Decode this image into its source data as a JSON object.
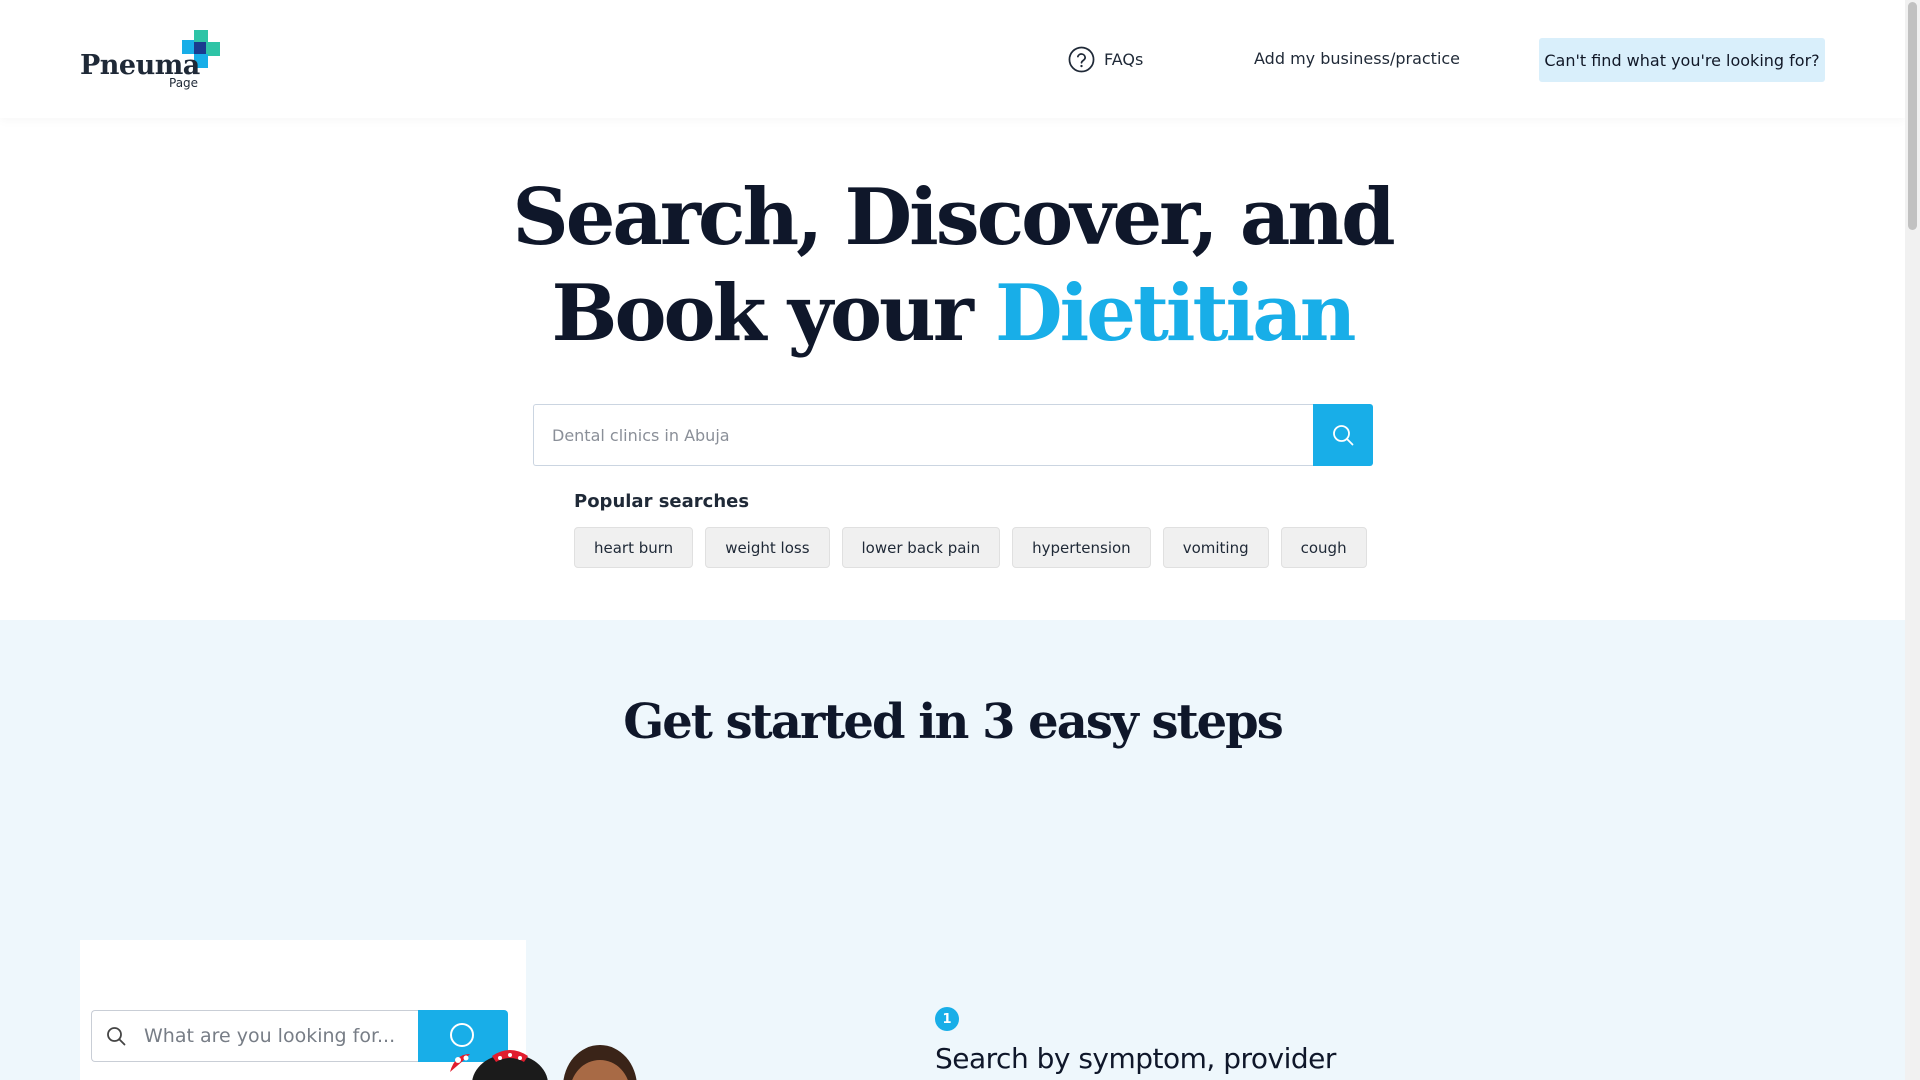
{
  "header": {
    "logo_text": "Pneuma",
    "logo_sub": "Page",
    "faq_label": "FAQs",
    "add_business_label": "Add my business/practice",
    "cta_label": "Can't find what you're looking for?"
  },
  "hero": {
    "title_line1": "Search, Discover, and",
    "title_line2_prefix": "Book your ",
    "title_accent": "Dietitian",
    "search_placeholder": "Dental clinics in Abuja",
    "popular_title": "Popular searches",
    "popular_chips": [
      "heart burn",
      "weight loss",
      "lower back pain",
      "hypertension",
      "vomiting",
      "cough"
    ]
  },
  "steps": {
    "title": "Get started in 3 easy steps",
    "illustration_placeholder": "What are you looking for...",
    "step1_number": "1",
    "step1_text": "Search by symptom, provider"
  },
  "colors": {
    "accent": "#18aee8",
    "cta_bg": "#d9effb",
    "section_bg": "#eef7fc",
    "logo_teal": "#2ec4a6",
    "logo_navy": "#1a3b8f"
  },
  "icons": [
    "question-circle-icon",
    "search-icon",
    "logo-cross-icon"
  ]
}
